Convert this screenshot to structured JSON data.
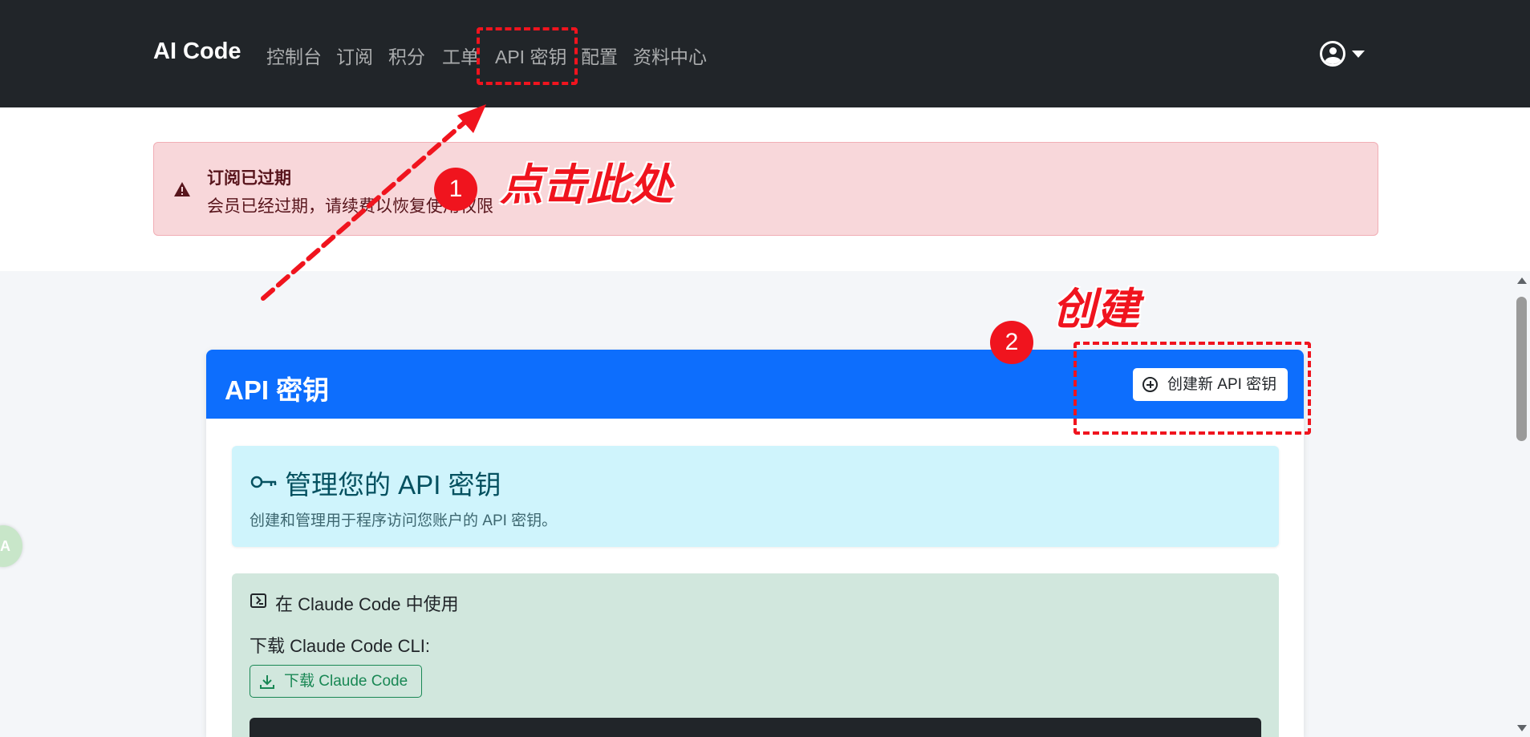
{
  "navbar": {
    "brand": "AI Code",
    "links": [
      "控制台",
      "订阅",
      "积分",
      "工单",
      "API 密钥",
      "配置",
      "资料中心"
    ]
  },
  "alert": {
    "title": "订阅已过期",
    "message": "会员已经过期，请续费以恢复使用权限"
  },
  "card": {
    "title": "API 密钥",
    "create_button": "创建新 API 密钥",
    "info_title": "管理您的 API 密钥",
    "info_subtitle": "创建和管理用于程序访问您账户的 API 密钥。",
    "use_title": "在 Claude Code 中使用",
    "download_label": "下载 Claude Code CLI:",
    "download_button": "下载 Claude Code"
  },
  "annotations": {
    "step1_number": "1",
    "step1_text": "点击此处",
    "step2_number": "2",
    "step2_text": "创建"
  },
  "translate_bubble": "A",
  "colors": {
    "navbar": "#212529",
    "primary": "#0d6efd",
    "alert_bg": "#f8d7da",
    "info_bg": "#cff4fc",
    "success_bg": "#d1e7dd",
    "annotation": "#f0141e"
  }
}
